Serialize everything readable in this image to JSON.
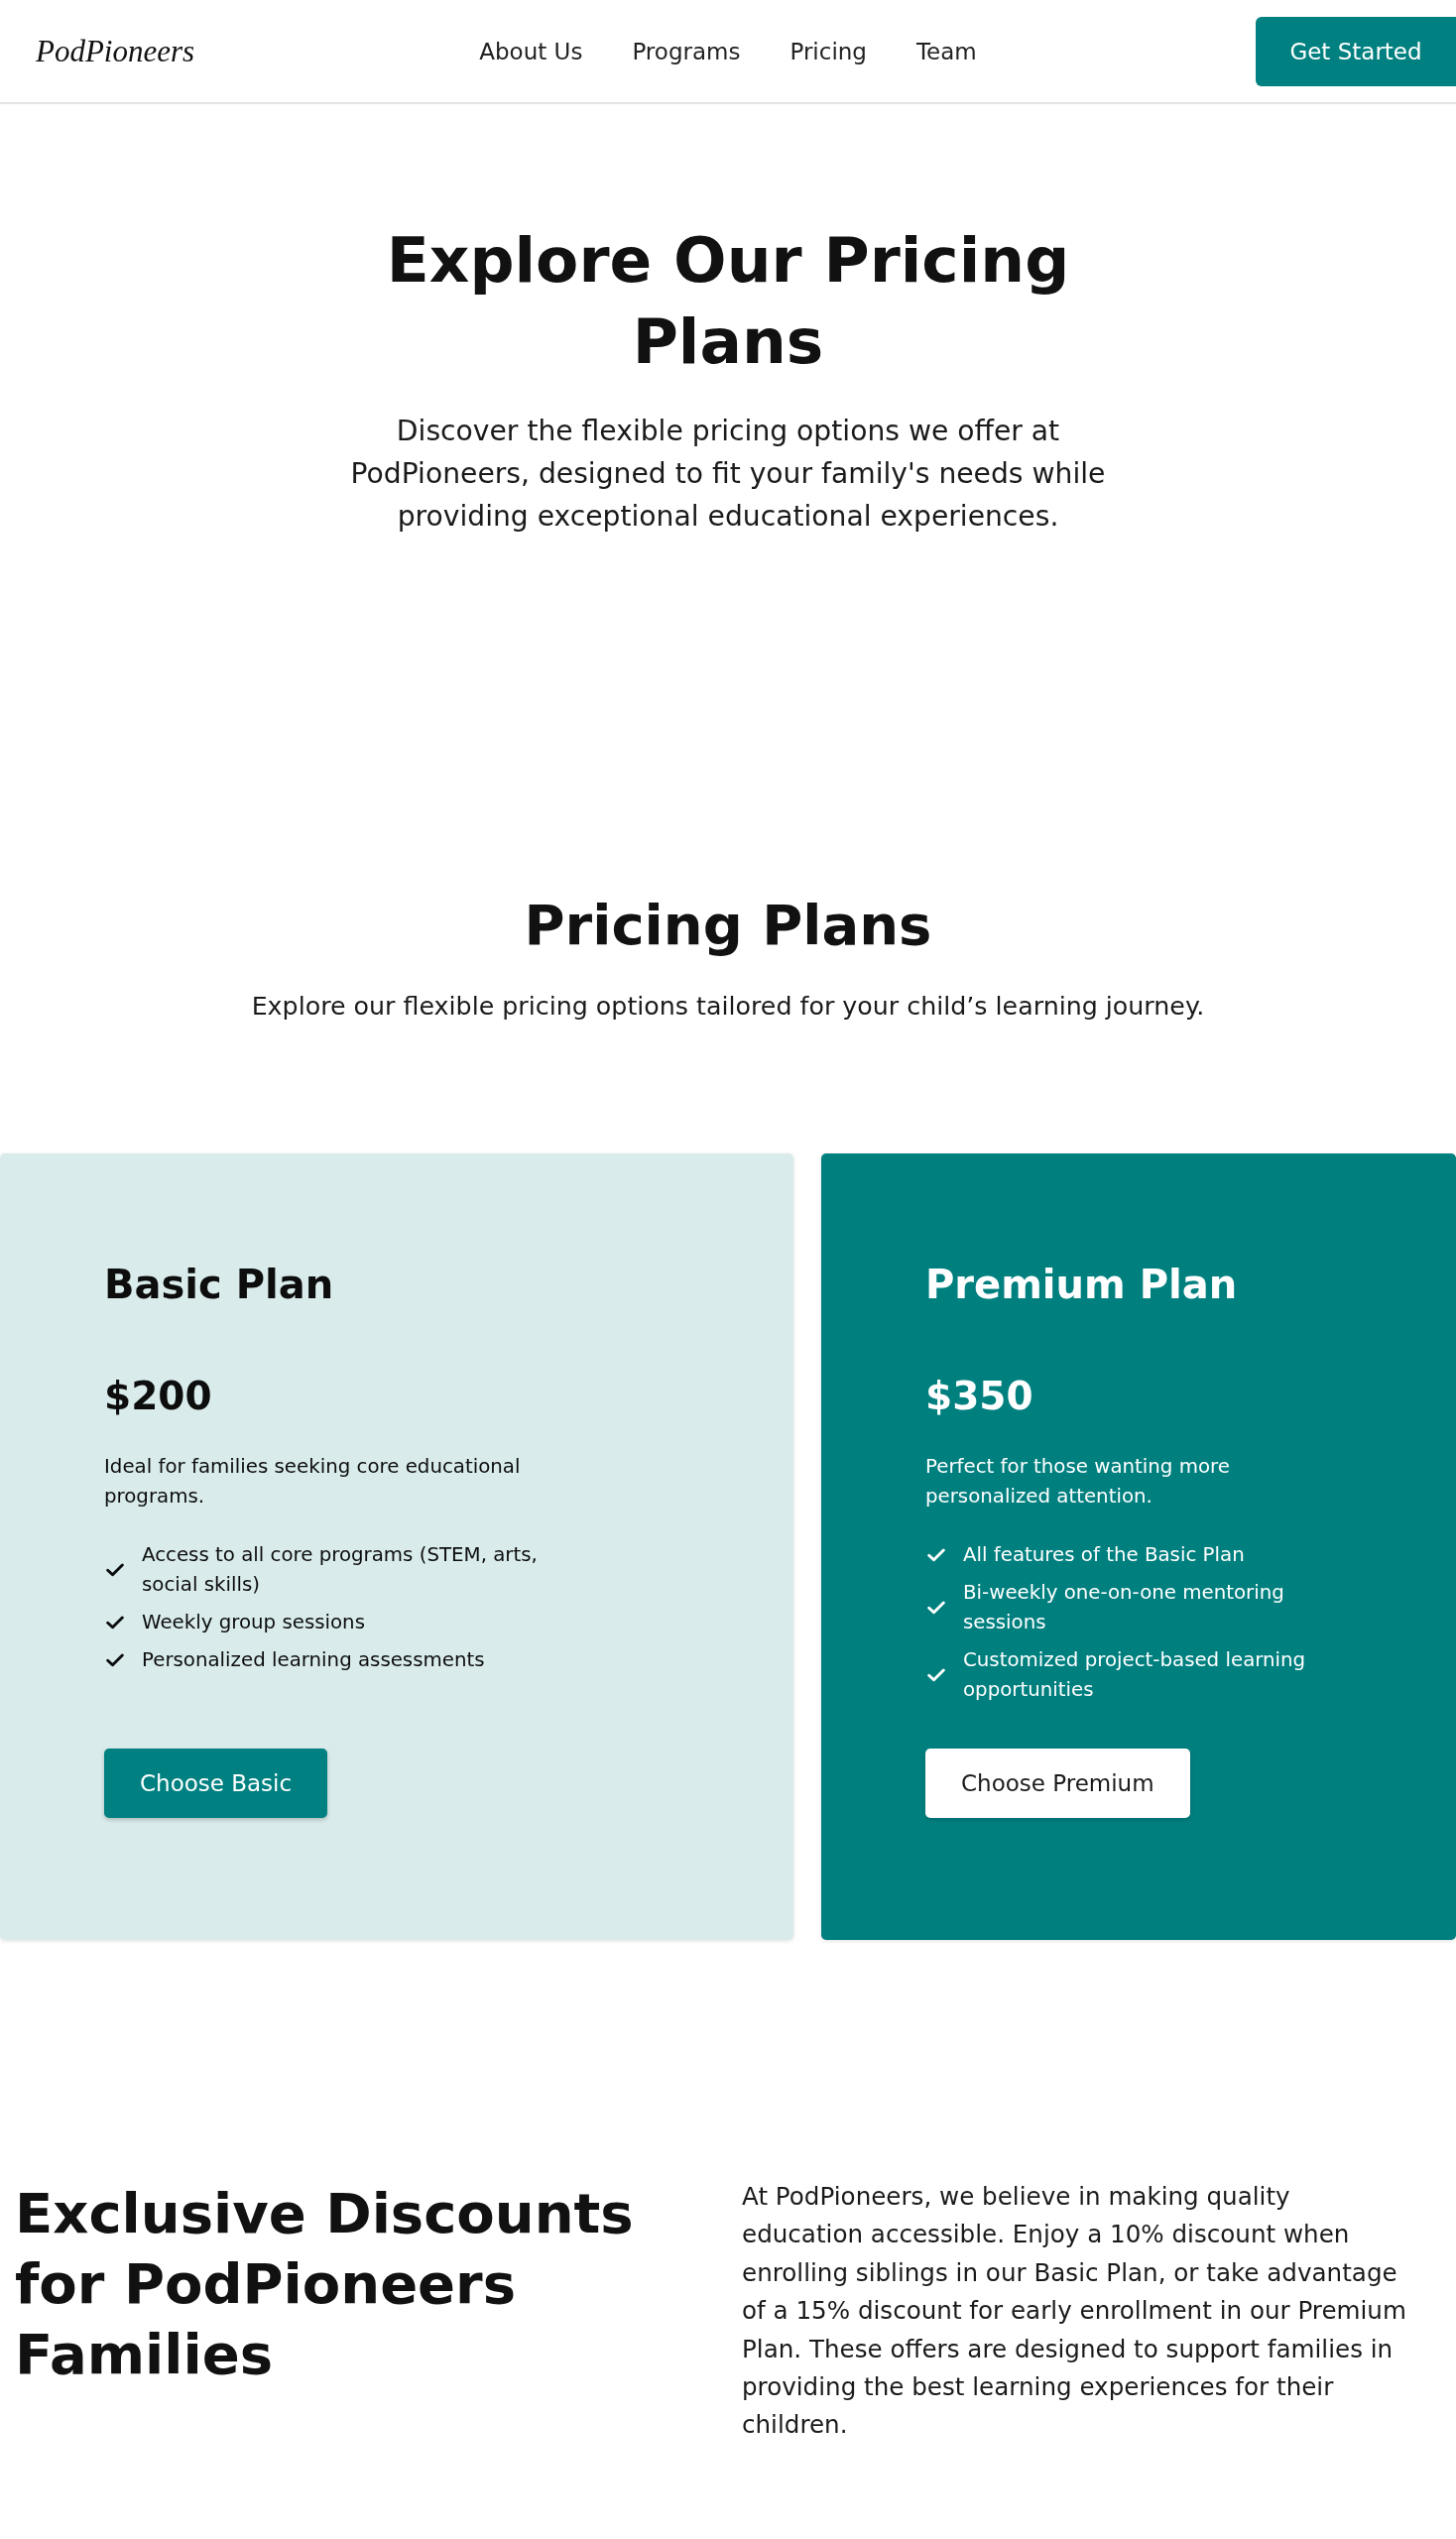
{
  "header": {
    "logo": "PodPioneers",
    "nav": [
      "About Us",
      "Programs",
      "Pricing",
      "Team"
    ],
    "cta": "Get Started"
  },
  "hero": {
    "title": "Explore Our Pricing Plans",
    "subtitle": "Discover the flexible pricing options we offer at PodPioneers, designed to fit your family's needs while providing exceptional educational experiences."
  },
  "pricing": {
    "title": "Pricing Plans",
    "subtitle": "Explore our flexible pricing options tailored for your child’s learning journey.",
    "plans": [
      {
        "kind": "standard",
        "name": "Basic Plan",
        "price": "$200",
        "description": "Ideal for families seeking core educational programs.",
        "features": [
          "Access to all core programs (STEM, arts, social skills)",
          "Weekly group sessions",
          "Personalized learning assessments"
        ],
        "button": "Choose Basic"
      },
      {
        "kind": "featured",
        "name": "Premium Plan",
        "price": "$350",
        "description": "Perfect for those wanting more personalized attention.",
        "features": [
          "All features of the Basic Plan",
          "Bi-weekly one-on-one mentoring sessions",
          "Customized project-based learning opportunities"
        ],
        "button": "Choose Premium"
      }
    ]
  },
  "discounts": {
    "title": "Exclusive Discounts for PodPioneers Families",
    "body": "At PodPioneers, we believe in making quality education accessible. Enjoy a 10% discount when enrolling siblings in our Basic Plan, or take advantage of a 15% discount for early enrollment in our Premium Plan. These offers are designed to support families in providing the best learning experiences for their children."
  }
}
